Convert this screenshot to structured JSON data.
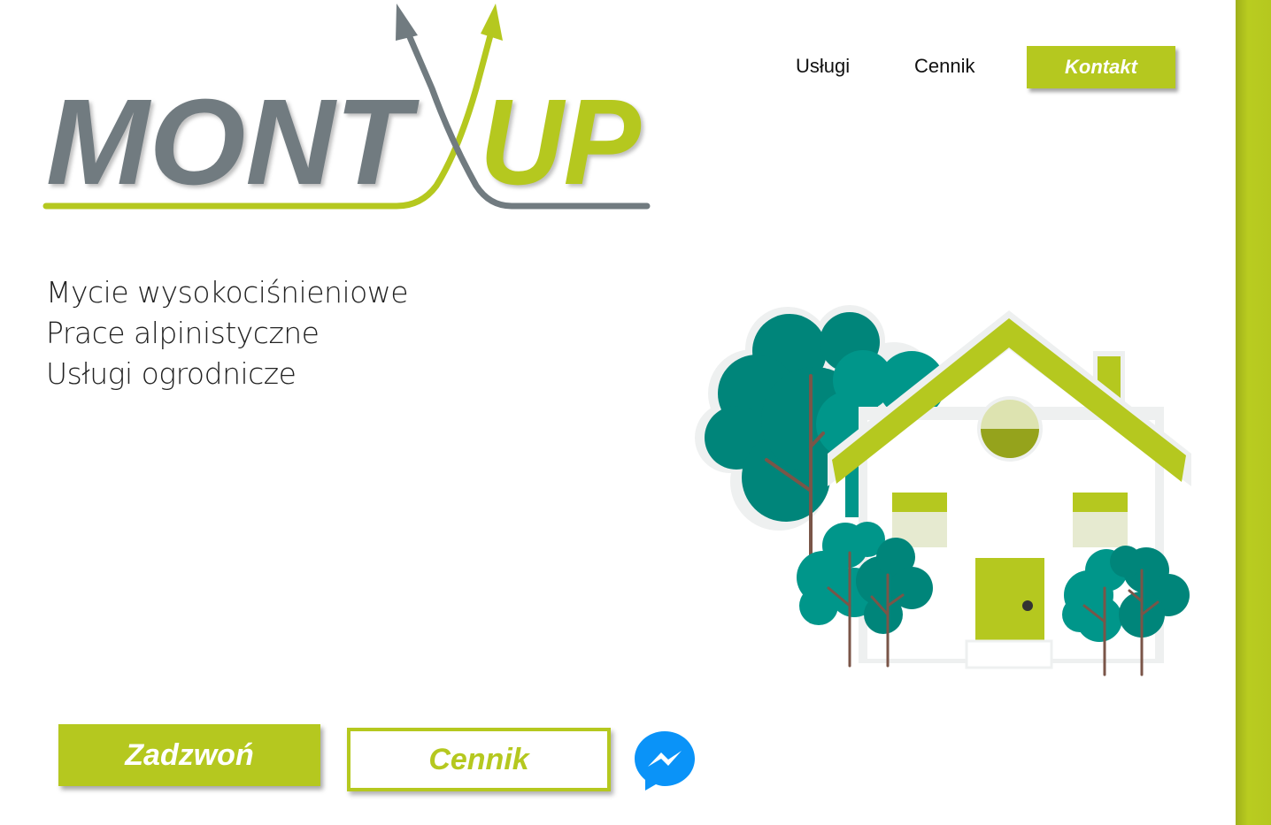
{
  "brand": {
    "logo_text_left": "MONT",
    "logo_text_right": "UP",
    "colors": {
      "accent": "#b5c81f",
      "logo_gray": "#717b80",
      "tree_dark": "#00857a",
      "tree_teal": "#00968a",
      "messenger_blue": "#0a93f8"
    }
  },
  "nav": {
    "items": [
      {
        "label": "Usługi"
      },
      {
        "label": "Cennik"
      }
    ],
    "contact_label": "Kontakt"
  },
  "services": [
    "Mycie wysokociśnieniowe",
    "Prace alpinistyczne",
    "Usługi ogrodnicze"
  ],
  "actions": {
    "call_label": "Zadzwoń",
    "price_label": "Cennik",
    "messenger_icon": "messenger-icon"
  }
}
